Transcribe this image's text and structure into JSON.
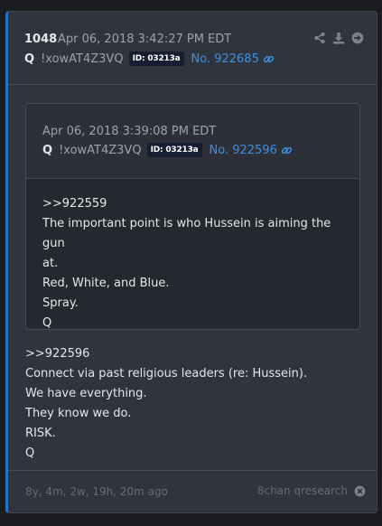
{
  "post": {
    "number": "1048",
    "timestamp": "Apr 06, 2018 3:42:27 PM EDT",
    "author": "Q",
    "tripcode": "!xowAT4Z3VQ",
    "user_id": "ID: 03213a",
    "post_no": "No. 922685",
    "icons": [
      "share-icon",
      "download-icon",
      "forward-icon",
      "link-icon"
    ],
    "body_lines": [
      ">>922596",
      "Connect via past religious leaders (re: Hussein).",
      "We have everything.",
      "They know we do.",
      "RISK.",
      "Q"
    ]
  },
  "quoted": {
    "timestamp": "Apr 06, 2018 3:39:08 PM EDT",
    "author": "Q",
    "tripcode": "!xowAT4Z3VQ",
    "user_id": "ID: 03213a",
    "post_no": "No. 922596",
    "body_lines": [
      ">>922559",
      "The important point is who Hussein is aiming the gun",
      "at.",
      "Red, White, and Blue.",
      "Spray.",
      "Q"
    ]
  },
  "footer": {
    "age": "8y, 4m, 2w, 19h, 20m ago",
    "source": "8chan qresearch"
  },
  "colors": {
    "accent": "#2a6fc9",
    "link": "#3e8fe3",
    "id_badge_bg": "#141f33"
  }
}
